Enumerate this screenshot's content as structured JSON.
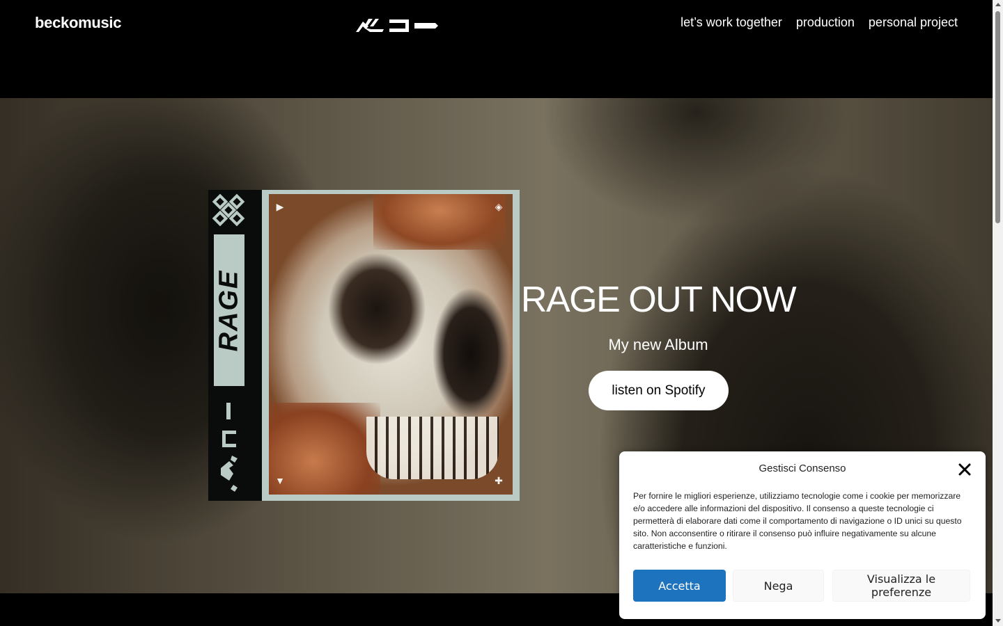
{
  "header": {
    "brand": "beckomusic",
    "nav": [
      "let’s work together",
      "production",
      "personal project"
    ]
  },
  "hero": {
    "album_spine_title": "RAGE",
    "title": "RAGE OUT NOW",
    "subtitle": "My new Album",
    "cta_label": "listen on Spotify"
  },
  "consent": {
    "title": "Gestisci Consenso",
    "text": "Per fornire le migliori esperienze, utilizziamo tecnologie come i cookie per memorizzare e/o accedere alle informazioni del dispositivo. Il consenso a queste tecnologie ci permetterà di elaborare dati come il comportamento di navigazione o ID unici su questo sito. Non acconsentire o ritirare il consenso può influire negativamente su alcune caratteristiche e funzioni.",
    "accept_label": "Accetta",
    "deny_label": "Nega",
    "prefs_label": "Visualizza le preferenze"
  },
  "colors": {
    "accept_blue": "#1e73be",
    "cover_mint": "#b9cbc4"
  },
  "icons": [
    "logo-glyph",
    "close-icon",
    "play-icon",
    "diamond-icon",
    "triangle-icon",
    "plus-icon",
    "knot-pattern-icon"
  ]
}
